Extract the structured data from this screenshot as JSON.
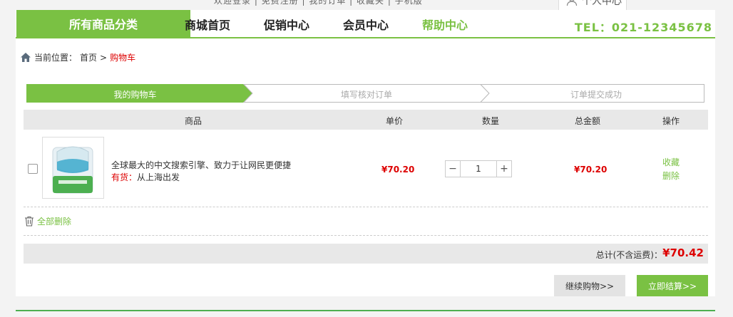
{
  "topbar": {
    "links_cut": "欢迎登录 | 免费注册 | 我的订单 | 收藏夹 | 手机版",
    "user_center": "个人中心"
  },
  "nav": {
    "category": "所有商品分类",
    "items": [
      {
        "label": "商城首页",
        "active": false
      },
      {
        "label": "促销中心",
        "active": false
      },
      {
        "label": "会员中心",
        "active": false
      },
      {
        "label": "帮助中心",
        "active": true
      }
    ],
    "tel": "TEL：021-12345678"
  },
  "breadcrumb": {
    "prefix": "当前位置：",
    "home": "首页",
    "sep": ">",
    "current": "购物车"
  },
  "steps": [
    "我的购物车",
    "填写核对订单",
    "订单提交成功"
  ],
  "table": {
    "headers": {
      "product": "商品",
      "unit_price": "单价",
      "quantity": "数量",
      "total": "总金额",
      "actions": "操作"
    },
    "rows": [
      {
        "name": "全球最大的中文搜索引擎、致力于让网民更便捷",
        "stock_label": "有货：",
        "ship_from": "从上海出发",
        "unit_price": "¥70.20",
        "qty": "1",
        "qty_minus": "−",
        "qty_plus": "+",
        "total": "¥70.20",
        "action_fav": "收藏",
        "action_del": "删除"
      }
    ]
  },
  "delete_all": "全部删除",
  "summary": {
    "label": "总计(不含运费)：",
    "amount": "¥70.42"
  },
  "buttons": {
    "continue": "继续购物>>",
    "checkout": "立即结算>>"
  },
  "colors": {
    "accent": "#7ac143",
    "price": "#dd0000"
  }
}
